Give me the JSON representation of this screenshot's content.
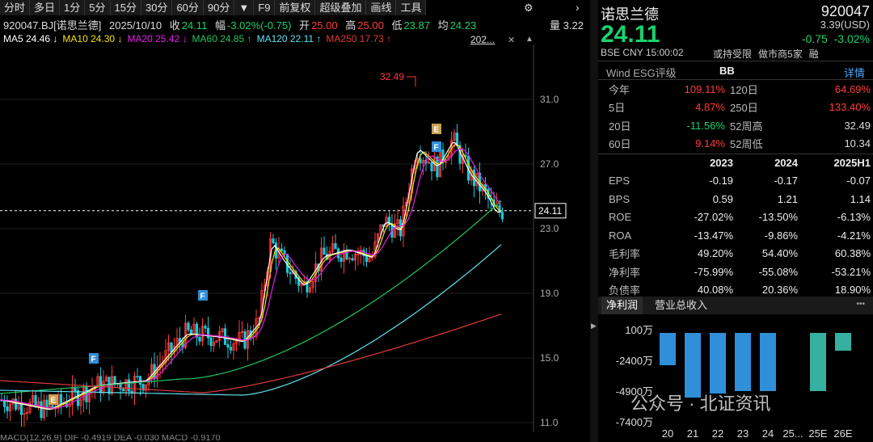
{
  "toolbar": {
    "items": [
      "分时",
      "多日",
      "1分",
      "5分",
      "15分",
      "30分",
      "60分",
      "90分",
      "▼",
      "F9",
      "前复权",
      "超级叠加",
      "画线",
      "工具"
    ],
    "gear": "⚙",
    "more": "›"
  },
  "info": {
    "code": "920047.BJ[诺思兰德]",
    "date": "2025/10/10",
    "close_label": "收",
    "close": "24.11",
    "chg_label": "幅",
    "chg": "-3.02%(-0.75)",
    "open_label": "开",
    "open": "25.00",
    "high_label": "高",
    "high": "25.00",
    "low_label": "低",
    "low": "23.87",
    "avg_label": "均",
    "avg": "24.23",
    "vol_label": "量",
    "vol": "3.22"
  },
  "ma": [
    {
      "label": "MA5 24.46",
      "arrow": "↓",
      "color": "#ffffff"
    },
    {
      "label": "MA10 24.30",
      "arrow": "↓",
      "color": "#f5e400"
    },
    {
      "label": "MA20 25.42",
      "arrow": "↓",
      "color": "#e61ee6"
    },
    {
      "label": "MA60 24.85",
      "arrow": "↑",
      "color": "#22c55e"
    },
    {
      "label": "MA120 22.11",
      "arrow": "↑",
      "color": "#5fe3f0"
    },
    {
      "label": "MA250 17.73",
      "arrow": "↑",
      "color": "#e03a3a"
    }
  ],
  "ma_tail": "202...",
  "axis": {
    "ticks": [
      "31.0",
      "27.0",
      "23.0",
      "19.0",
      "15.0",
      "11.0"
    ],
    "current": "24.11",
    "peak": "32.49"
  },
  "badges": {
    "f": "F",
    "e": "E"
  },
  "bottom_strip": "MACD(12,26,9) DIF -0.4919 DEA -0.030 MACD -0.9170",
  "panel": {
    "name": "诺思兰德",
    "code": "920047",
    "price": "24.11",
    "usd": "3.39(USD)",
    "change": "-0.75",
    "pct": "-3.02%",
    "exch": "BSE",
    "cur": "CNY",
    "time": "15:00:02",
    "tags": [
      "或持受限",
      "做市商5家",
      "融"
    ],
    "esg_label": "Wind ESG评级",
    "esg": "BB",
    "detail": "详情",
    "perf": [
      [
        "今年",
        "109.11%",
        "r",
        "120日",
        "64.69%",
        "r"
      ],
      [
        "5日",
        "4.87%",
        "r",
        "250日",
        "133.40%",
        "r"
      ],
      [
        "20日",
        "-11.56%",
        "g",
        "52周高",
        "32.49",
        "w"
      ],
      [
        "60日",
        "9.14%",
        "r",
        "52周低",
        "10.34",
        "w"
      ]
    ],
    "fin_head": [
      "",
      "2023",
      "2024",
      "2025H1"
    ],
    "fin": [
      [
        "EPS",
        "-0.19",
        "-0.17",
        "-0.07"
      ],
      [
        "BPS",
        "0.59",
        "1.21",
        "1.14"
      ],
      [
        "ROE",
        "-27.02%",
        "-13.50%",
        "-6.13%"
      ],
      [
        "ROA",
        "-13.47%",
        "-9.86%",
        "-4.21%"
      ],
      [
        "毛利率",
        "49.20%",
        "54.40%",
        "60.38%"
      ],
      [
        "净利率",
        "-75.99%",
        "-55.08%",
        "-53.21%"
      ],
      [
        "负债率",
        "40.08%",
        "20.36%",
        "18.90%"
      ]
    ],
    "tabs": [
      "净利润",
      "营业总收入"
    ],
    "dots": "•••",
    "bar_y": [
      "100万",
      "-2400万",
      "-4900万",
      "-7400万"
    ],
    "bar_x": [
      "20",
      "21",
      "22",
      "23",
      "24",
      "25...",
      "25E",
      "26E"
    ],
    "watermark": "公众号 · 北证资讯"
  },
  "chart_data": {
    "type": "line",
    "ylim": [
      10.34,
      32.49
    ],
    "series": [
      {
        "name": "MA5",
        "values": [
          24.46
        ]
      },
      {
        "name": "MA10",
        "values": [
          24.3
        ]
      },
      {
        "name": "MA20",
        "values": [
          25.42
        ]
      },
      {
        "name": "MA60",
        "values": [
          24.85
        ]
      },
      {
        "name": "MA120",
        "values": [
          22.11
        ]
      },
      {
        "name": "MA250",
        "values": [
          17.73
        ]
      }
    ],
    "net_profit_bars": {
      "categories": [
        "20",
        "21",
        "22",
        "23",
        "24",
        "25...",
        "25E",
        "26E"
      ],
      "colors": [
        "#2f8fd8",
        "#2f8fd8",
        "#2f8fd8",
        "#2f8fd8",
        "#2f8fd8",
        "#2f8fd8",
        "#36b0a0",
        "#36b0a0"
      ]
    }
  }
}
